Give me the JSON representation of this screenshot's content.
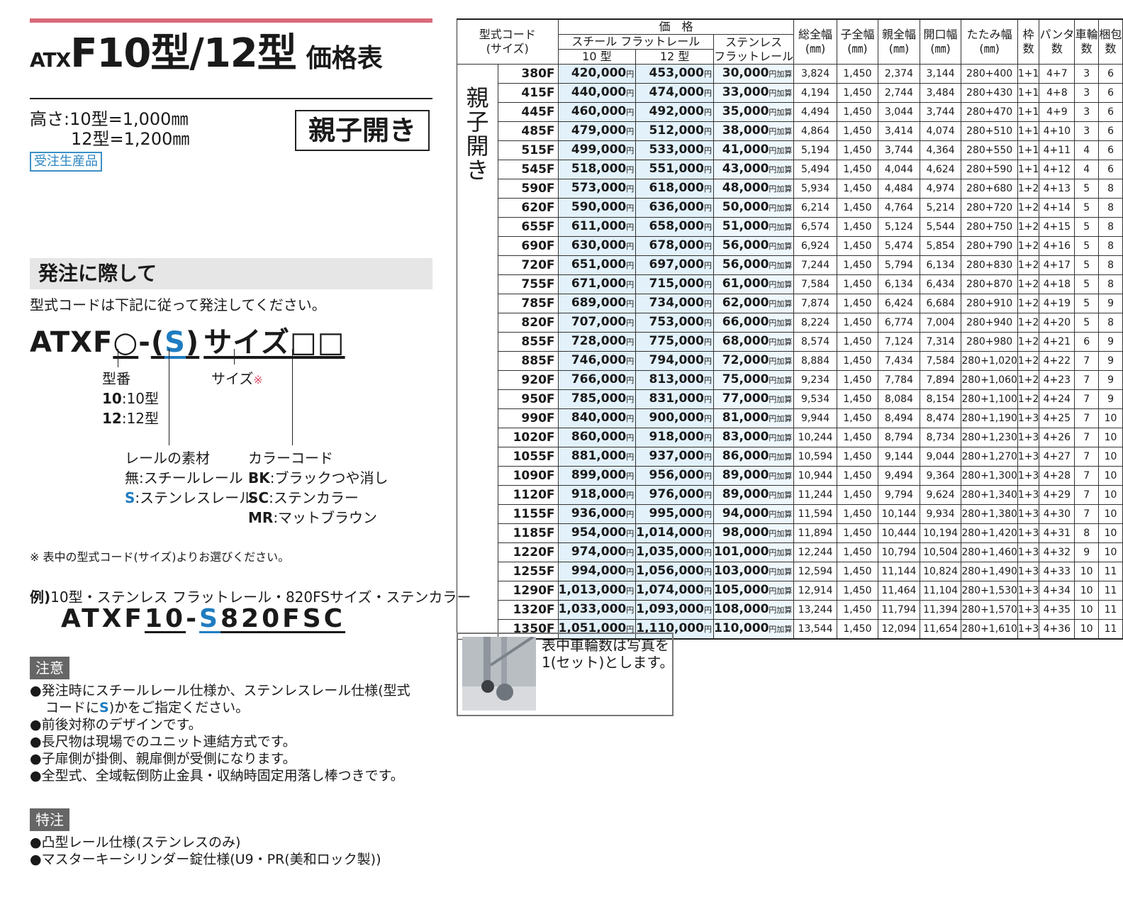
{
  "title": {
    "prefix": "ATX",
    "main": "F10型/12型",
    "suffix": "価格表"
  },
  "height_line1": "高さ:10型=1,000㎜",
  "height_line2": "12型=1,200㎜",
  "door_type": "親子開き",
  "badge": "受注生産品",
  "order_section": {
    "title": "発注に際して",
    "note": "型式コードは下記に従って発注してください。",
    "code": {
      "prefix": "ATXF",
      "model": "○",
      "dash": "-",
      "open": "(",
      "rail": "S",
      "close": ")",
      "size": "サイズ",
      "color": "□□"
    },
    "model_label": "型番",
    "model_10_code": "10",
    "model_10_text": ":10型",
    "model_12_code": "12",
    "model_12_text": ":12型",
    "size_label": "サイズ",
    "size_mark": "※",
    "rail_label": "レールの素材",
    "rail_none": "無:スチールレール",
    "rail_s_code": "S",
    "rail_s_text": ":ステンレスレール",
    "color_label": "カラーコード",
    "color_bk_code": "BK",
    "color_bk_text": ":ブラックつや消し",
    "color_sc_code": "SC",
    "color_sc_text": ":ステンカラー",
    "color_mr_code": "MR",
    "color_mr_text": ":マットブラウン",
    "footnote": "※ 表中の型式コード(サイズ)よりお選びください。",
    "example_label": "例)",
    "example_text": "10型・ステンレス フラットレール・820FSサイズ・ステンカラー",
    "example_code": {
      "a": "ATXF",
      "b": "10",
      "c": "-",
      "d": "S",
      "e": "820FSC"
    }
  },
  "caution": {
    "title": "注意",
    "item1_a": "●発注時にスチールレール仕様か、ステンレスレール仕様(型式",
    "item1_b": "コードに",
    "item1_s": "S",
    "item1_c": ")かをご指定ください。",
    "item2": "●前後対称のデザインです。",
    "item3": "●長尺物は現場でのユニット連結方式です。",
    "item4": "●子扉側が掛側、親扉側が受側になります。",
    "item5": "●全型式、全域転倒防止金具・収納時固定用落し棒つきです。"
  },
  "special": {
    "title": "特注",
    "item1": "●凸型レール仕様(ステンレスのみ)",
    "item2": "●マスターキーシリンダー錠仕様(U9・PR(美和ロック製))"
  },
  "table_headers": {
    "model_code": "型式コード",
    "model_size": "(サイズ)",
    "price": "価　格",
    "steel": "スチール フラットレール",
    "stainless_a": "ステンレス",
    "stainless_b": "フラットレール",
    "t10": "10 型",
    "t12": "12 型",
    "total_w": "総全幅",
    "child_w": "子全幅",
    "parent_w": "親全幅",
    "open_w": "開口幅",
    "fold_w": "たたみ幅",
    "mm": "(㎜)",
    "frame": "枠",
    "frame2": "数",
    "panta": "パンタ",
    "panta2": "数",
    "wheel": "車輪",
    "wheel2": "数",
    "pack": "梱包",
    "pack2": "数"
  },
  "row_group_label": "親子開き",
  "yen": "円",
  "add_suffix": "円加算",
  "rows": [
    {
      "code": "380F",
      "p10": "420,000",
      "p12": "453,000",
      "sus": "30,000",
      "total": "3,824",
      "child": "1,450",
      "parent": "2,374",
      "open": "3,144",
      "fold": "280+400",
      "frame": "1+1",
      "panta": "4+7",
      "wheel": "3",
      "pack": "6"
    },
    {
      "code": "415F",
      "p10": "440,000",
      "p12": "474,000",
      "sus": "33,000",
      "total": "4,194",
      "child": "1,450",
      "parent": "2,744",
      "open": "3,484",
      "fold": "280+430",
      "frame": "1+1",
      "panta": "4+8",
      "wheel": "3",
      "pack": "6"
    },
    {
      "code": "445F",
      "p10": "460,000",
      "p12": "492,000",
      "sus": "35,000",
      "total": "4,494",
      "child": "1,450",
      "parent": "3,044",
      "open": "3,744",
      "fold": "280+470",
      "frame": "1+1",
      "panta": "4+9",
      "wheel": "3",
      "pack": "6"
    },
    {
      "code": "485F",
      "p10": "479,000",
      "p12": "512,000",
      "sus": "38,000",
      "total": "4,864",
      "child": "1,450",
      "parent": "3,414",
      "open": "4,074",
      "fold": "280+510",
      "frame": "1+1",
      "panta": "4+10",
      "wheel": "3",
      "pack": "6"
    },
    {
      "code": "515F",
      "p10": "499,000",
      "p12": "533,000",
      "sus": "41,000",
      "total": "5,194",
      "child": "1,450",
      "parent": "3,744",
      "open": "4,364",
      "fold": "280+550",
      "frame": "1+1",
      "panta": "4+11",
      "wheel": "4",
      "pack": "6"
    },
    {
      "code": "545F",
      "p10": "518,000",
      "p12": "551,000",
      "sus": "43,000",
      "total": "5,494",
      "child": "1,450",
      "parent": "4,044",
      "open": "4,624",
      "fold": "280+590",
      "frame": "1+1",
      "panta": "4+12",
      "wheel": "4",
      "pack": "6"
    },
    {
      "code": "590F",
      "p10": "573,000",
      "p12": "618,000",
      "sus": "48,000",
      "total": "5,934",
      "child": "1,450",
      "parent": "4,484",
      "open": "4,974",
      "fold": "280+680",
      "frame": "1+2",
      "panta": "4+13",
      "wheel": "5",
      "pack": "8"
    },
    {
      "code": "620F",
      "p10": "590,000",
      "p12": "636,000",
      "sus": "50,000",
      "total": "6,214",
      "child": "1,450",
      "parent": "4,764",
      "open": "5,214",
      "fold": "280+720",
      "frame": "1+2",
      "panta": "4+14",
      "wheel": "5",
      "pack": "8"
    },
    {
      "code": "655F",
      "p10": "611,000",
      "p12": "658,000",
      "sus": "51,000",
      "total": "6,574",
      "child": "1,450",
      "parent": "5,124",
      "open": "5,544",
      "fold": "280+750",
      "frame": "1+2",
      "panta": "4+15",
      "wheel": "5",
      "pack": "8"
    },
    {
      "code": "690F",
      "p10": "630,000",
      "p12": "678,000",
      "sus": "56,000",
      "total": "6,924",
      "child": "1,450",
      "parent": "5,474",
      "open": "5,854",
      "fold": "280+790",
      "frame": "1+2",
      "panta": "4+16",
      "wheel": "5",
      "pack": "8"
    },
    {
      "code": "720F",
      "p10": "651,000",
      "p12": "697,000",
      "sus": "56,000",
      "total": "7,244",
      "child": "1,450",
      "parent": "5,794",
      "open": "6,134",
      "fold": "280+830",
      "frame": "1+2",
      "panta": "4+17",
      "wheel": "5",
      "pack": "8"
    },
    {
      "code": "755F",
      "p10": "671,000",
      "p12": "715,000",
      "sus": "61,000",
      "total": "7,584",
      "child": "1,450",
      "parent": "6,134",
      "open": "6,434",
      "fold": "280+870",
      "frame": "1+2",
      "panta": "4+18",
      "wheel": "5",
      "pack": "8"
    },
    {
      "code": "785F",
      "p10": "689,000",
      "p12": "734,000",
      "sus": "62,000",
      "total": "7,874",
      "child": "1,450",
      "parent": "6,424",
      "open": "6,684",
      "fold": "280+910",
      "frame": "1+2",
      "panta": "4+19",
      "wheel": "5",
      "pack": "9"
    },
    {
      "code": "820F",
      "p10": "707,000",
      "p12": "753,000",
      "sus": "66,000",
      "total": "8,224",
      "child": "1,450",
      "parent": "6,774",
      "open": "7,004",
      "fold": "280+940",
      "frame": "1+2",
      "panta": "4+20",
      "wheel": "5",
      "pack": "8"
    },
    {
      "code": "855F",
      "p10": "728,000",
      "p12": "775,000",
      "sus": "68,000",
      "total": "8,574",
      "child": "1,450",
      "parent": "7,124",
      "open": "7,314",
      "fold": "280+980",
      "frame": "1+2",
      "panta": "4+21",
      "wheel": "6",
      "pack": "9"
    },
    {
      "code": "885F",
      "p10": "746,000",
      "p12": "794,000",
      "sus": "72,000",
      "total": "8,884",
      "child": "1,450",
      "parent": "7,434",
      "open": "7,584",
      "fold": "280+1,020",
      "frame": "1+2",
      "panta": "4+22",
      "wheel": "7",
      "pack": "9"
    },
    {
      "code": "920F",
      "p10": "766,000",
      "p12": "813,000",
      "sus": "75,000",
      "total": "9,234",
      "child": "1,450",
      "parent": "7,784",
      "open": "7,894",
      "fold": "280+1,060",
      "frame": "1+2",
      "panta": "4+23",
      "wheel": "7",
      "pack": "9"
    },
    {
      "code": "950F",
      "p10": "785,000",
      "p12": "831,000",
      "sus": "77,000",
      "total": "9,534",
      "child": "1,450",
      "parent": "8,084",
      "open": "8,154",
      "fold": "280+1,100",
      "frame": "1+2",
      "panta": "4+24",
      "wheel": "7",
      "pack": "9"
    },
    {
      "code": "990F",
      "p10": "840,000",
      "p12": "900,000",
      "sus": "81,000",
      "total": "9,944",
      "child": "1,450",
      "parent": "8,494",
      "open": "8,474",
      "fold": "280+1,190",
      "frame": "1+3",
      "panta": "4+25",
      "wheel": "7",
      "pack": "10"
    },
    {
      "code": "1020F",
      "p10": "860,000",
      "p12": "918,000",
      "sus": "83,000",
      "total": "10,244",
      "child": "1,450",
      "parent": "8,794",
      "open": "8,734",
      "fold": "280+1,230",
      "frame": "1+3",
      "panta": "4+26",
      "wheel": "7",
      "pack": "10"
    },
    {
      "code": "1055F",
      "p10": "881,000",
      "p12": "937,000",
      "sus": "86,000",
      "total": "10,594",
      "child": "1,450",
      "parent": "9,144",
      "open": "9,044",
      "fold": "280+1,270",
      "frame": "1+3",
      "panta": "4+27",
      "wheel": "7",
      "pack": "10"
    },
    {
      "code": "1090F",
      "p10": "899,000",
      "p12": "956,000",
      "sus": "89,000",
      "total": "10,944",
      "child": "1,450",
      "parent": "9,494",
      "open": "9,364",
      "fold": "280+1,300",
      "frame": "1+3",
      "panta": "4+28",
      "wheel": "7",
      "pack": "10"
    },
    {
      "code": "1120F",
      "p10": "918,000",
      "p12": "976,000",
      "sus": "89,000",
      "total": "11,244",
      "child": "1,450",
      "parent": "9,794",
      "open": "9,624",
      "fold": "280+1,340",
      "frame": "1+3",
      "panta": "4+29",
      "wheel": "7",
      "pack": "10"
    },
    {
      "code": "1155F",
      "p10": "936,000",
      "p12": "995,000",
      "sus": "94,000",
      "total": "11,594",
      "child": "1,450",
      "parent": "10,144",
      "open": "9,934",
      "fold": "280+1,380",
      "frame": "1+3",
      "panta": "4+30",
      "wheel": "7",
      "pack": "10"
    },
    {
      "code": "1185F",
      "p10": "954,000",
      "p12": "1,014,000",
      "sus": "98,000",
      "total": "11,894",
      "child": "1,450",
      "parent": "10,444",
      "open": "10,194",
      "fold": "280+1,420",
      "frame": "1+3",
      "panta": "4+31",
      "wheel": "8",
      "pack": "10"
    },
    {
      "code": "1220F",
      "p10": "974,000",
      "p12": "1,035,000",
      "sus": "101,000",
      "total": "12,244",
      "child": "1,450",
      "parent": "10,794",
      "open": "10,504",
      "fold": "280+1,460",
      "frame": "1+3",
      "panta": "4+32",
      "wheel": "9",
      "pack": "10"
    },
    {
      "code": "1255F",
      "p10": "994,000",
      "p12": "1,056,000",
      "sus": "103,000",
      "total": "12,594",
      "child": "1,450",
      "parent": "11,144",
      "open": "10,824",
      "fold": "280+1,490",
      "frame": "1+3",
      "panta": "4+33",
      "wheel": "10",
      "pack": "11"
    },
    {
      "code": "1290F",
      "p10": "1,013,000",
      "p12": "1,074,000",
      "sus": "105,000",
      "total": "12,914",
      "child": "1,450",
      "parent": "11,464",
      "open": "11,104",
      "fold": "280+1,530",
      "frame": "1+3",
      "panta": "4+34",
      "wheel": "10",
      "pack": "11"
    },
    {
      "code": "1320F",
      "p10": "1,033,000",
      "p12": "1,093,000",
      "sus": "108,000",
      "total": "13,244",
      "child": "1,450",
      "parent": "11,794",
      "open": "11,394",
      "fold": "280+1,570",
      "frame": "1+3",
      "panta": "4+35",
      "wheel": "10",
      "pack": "11"
    },
    {
      "code": "1350F",
      "p10": "1,051,000",
      "p12": "1,110,000",
      "sus": "110,000",
      "total": "13,544",
      "child": "1,450",
      "parent": "12,094",
      "open": "11,654",
      "fold": "280+1,610",
      "frame": "1+3",
      "panta": "4+36",
      "wheel": "10",
      "pack": "11"
    }
  ],
  "wheel_note_line1": "表中車輪数は写真を",
  "wheel_note_line2": "1(セット)とします。"
}
